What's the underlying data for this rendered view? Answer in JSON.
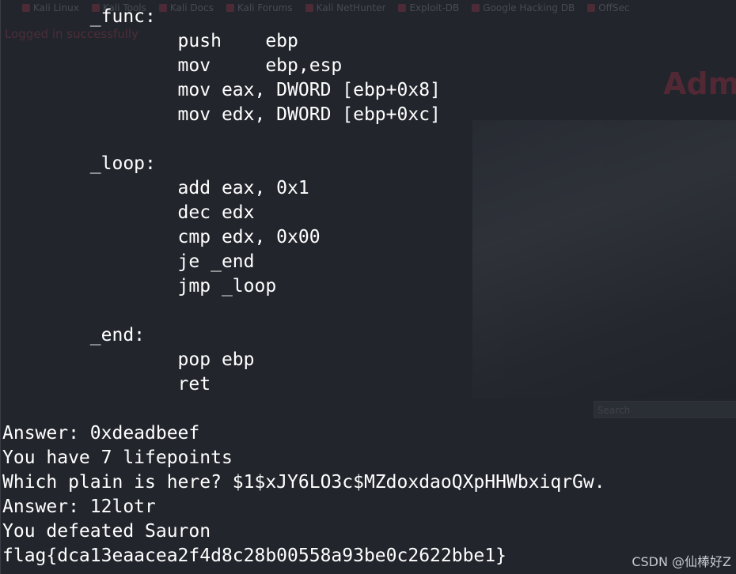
{
  "background": {
    "bookmarks": [
      "Kali Linux",
      "Kali Tools",
      "Kali Docs",
      "Kali Forums",
      "Kali NetHunter",
      "Exploit-DB",
      "Google Hacking DB",
      "OffSec"
    ],
    "status_text": "Logged in successfully",
    "heading": "Adm",
    "input_placeholder": "Search"
  },
  "terminal": {
    "lines": [
      "        _func:",
      "                push    ebp",
      "                mov     ebp,esp",
      "                mov eax, DWORD [ebp+0x8]",
      "                mov edx, DWORD [ebp+0xc]",
      "",
      "        _loop:",
      "                add eax, 0x1",
      "                dec edx",
      "                cmp edx, 0x00",
      "                je _end",
      "                jmp _loop",
      "",
      "        _end:",
      "                pop ebp",
      "                ret",
      "",
      "Answer: 0xdeadbeef",
      "You have 7 lifepoints",
      "Which plain is here? $1$xJY6LO3c$MZdoxdaoQXpHHWbxiqrGw.",
      "Answer: 12lotr",
      "You defeated Sauron",
      "flag{dca13eaacea2f4d8c28b00558a93be0c2622bbe1}",
      "                              "
    ]
  },
  "watermark": "CSDN @仙棒好Z",
  "colors": {
    "terminal_bg": "#22252c",
    "terminal_fg": "#ffffff",
    "accent": "#ff3355"
  }
}
